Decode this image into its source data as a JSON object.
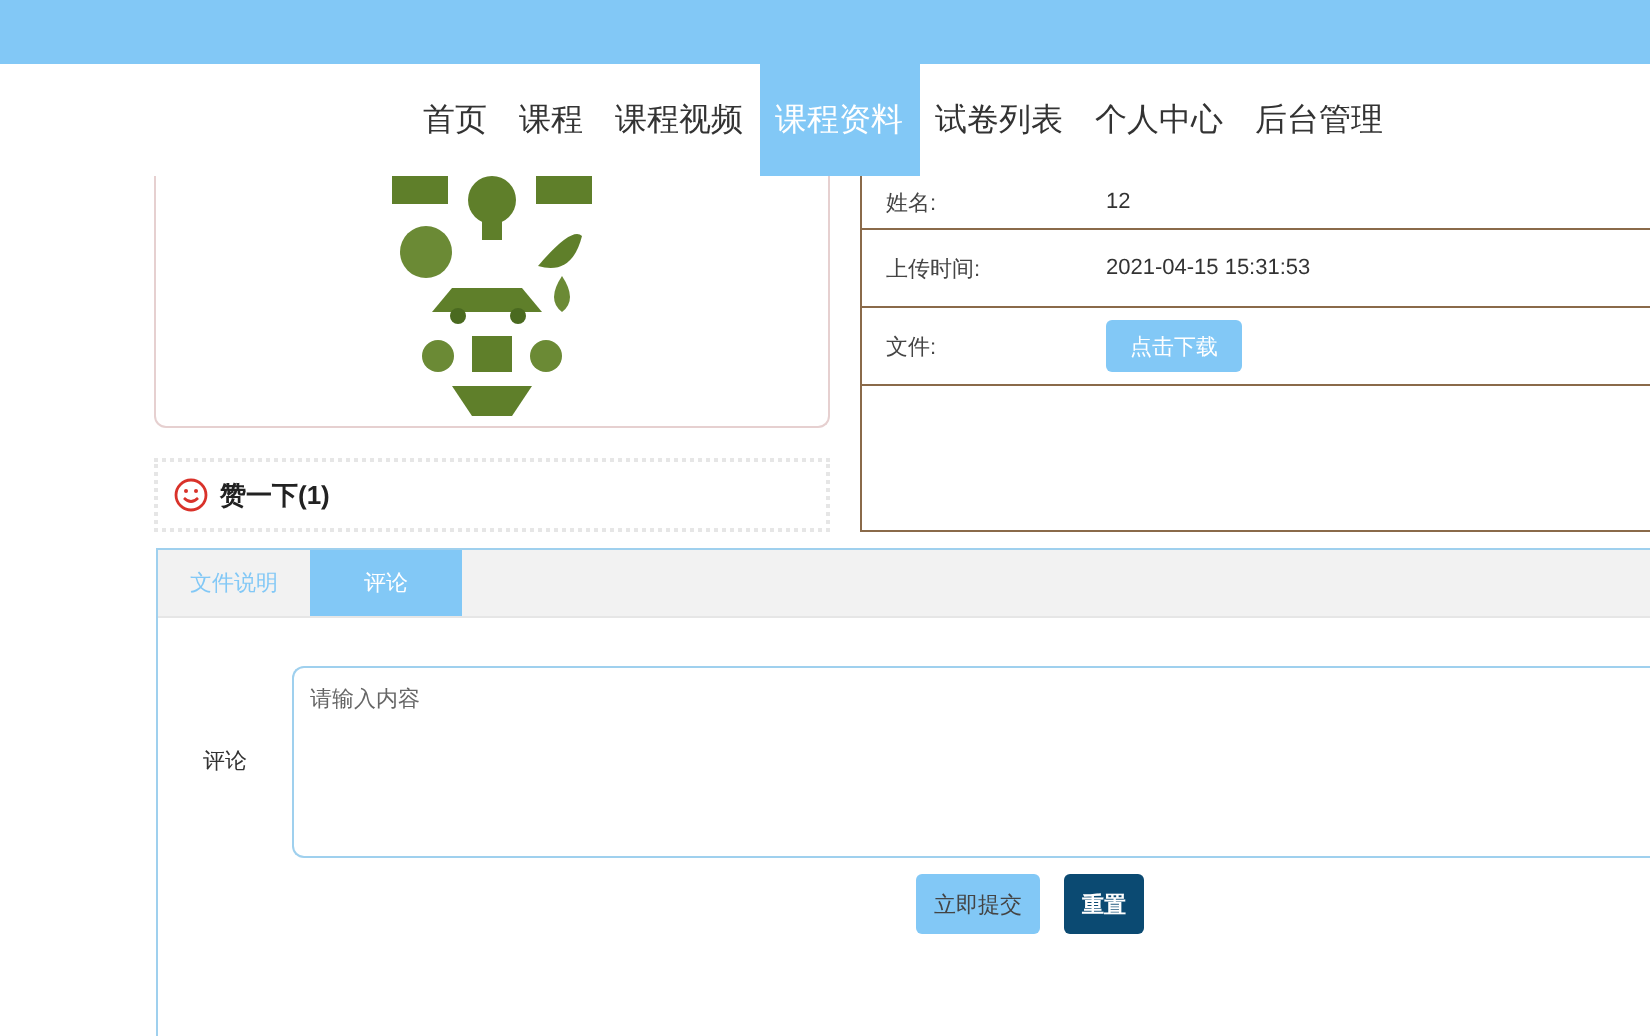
{
  "nav": {
    "items": [
      {
        "label": "首页",
        "selected": false
      },
      {
        "label": "课程",
        "selected": false
      },
      {
        "label": "课程视频",
        "selected": false
      },
      {
        "label": "课程资料",
        "selected": true
      },
      {
        "label": "试卷列表",
        "selected": false
      },
      {
        "label": "个人中心",
        "selected": false
      },
      {
        "label": "后台管理",
        "selected": false
      }
    ]
  },
  "like": {
    "label": "赞一下(1)"
  },
  "details": {
    "rows": [
      {
        "label": "姓名:",
        "kind": "text",
        "value": "12"
      },
      {
        "label": "上传时间:",
        "kind": "text",
        "value": "2021-04-15 15:31:53"
      },
      {
        "label": "文件:",
        "kind": "button",
        "value": "点击下载"
      }
    ]
  },
  "tabs": [
    {
      "label": "文件说明",
      "selected": false
    },
    {
      "label": "评论",
      "selected": true
    }
  ],
  "comment_form": {
    "label": "评论",
    "placeholder": "请输入内容",
    "buttons": [
      {
        "label": "立即提交",
        "kind": "primary"
      },
      {
        "label": "重置",
        "kind": "dark"
      }
    ]
  }
}
